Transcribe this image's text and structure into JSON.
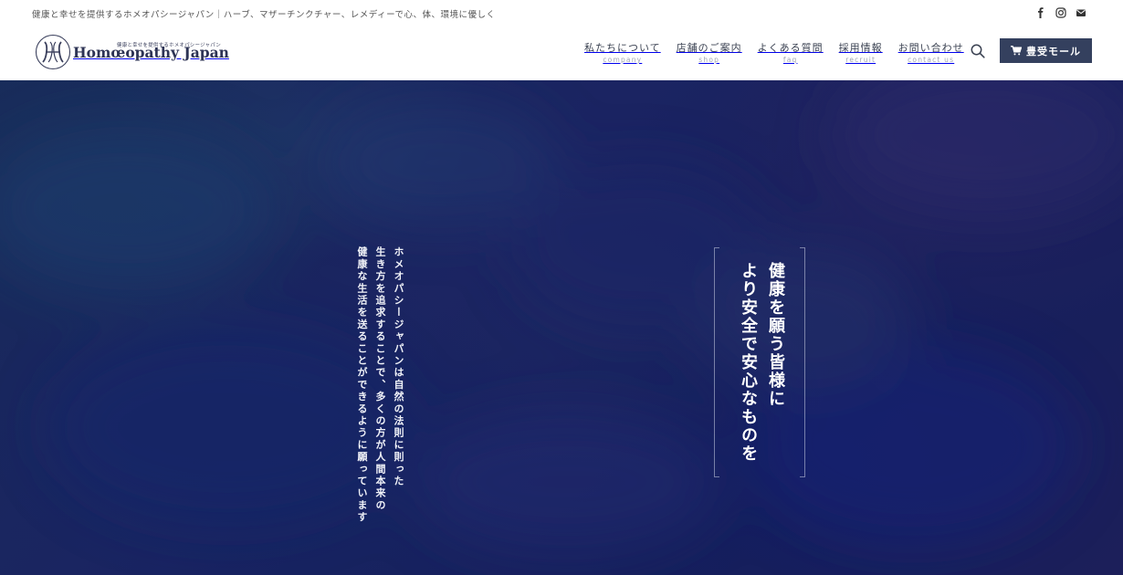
{
  "topbar": {
    "tagline": "健康と幸せを提供するホメオパシージャパン｜ハーブ、マザーチンクチャー、レメディーで心、体、環境に優しく",
    "social": [
      {
        "icon": "facebook-icon"
      },
      {
        "icon": "instagram-icon"
      },
      {
        "icon": "mail-icon"
      }
    ]
  },
  "header": {
    "logo": {
      "sub": "健康と幸せを提供するホメオパシージャパン",
      "main": "Homœopathy Japan"
    },
    "nav": [
      {
        "jp": "私たちについて",
        "en": "company"
      },
      {
        "jp": "店舗のご案内",
        "en": "shop"
      },
      {
        "jp": "よくある質問",
        "en": "faq"
      },
      {
        "jp": "採用情報",
        "en": "recruit"
      },
      {
        "jp": "お問い合わせ",
        "en": "contact us"
      }
    ],
    "search_icon": "search-icon",
    "shop_button": {
      "label": "豊受モール",
      "icon": "cart-icon"
    }
  },
  "hero": {
    "headline_lines": [
      "健康を願う皆様に",
      "より安全で安心なものを"
    ],
    "body_lines": [
      "ホメオパシージャパンは自然の法則に則った",
      "生き方を追求することで、多くの方が人間本来の",
      "健康な生活を送ることができるように願っています"
    ]
  },
  "colors": {
    "brand_navy": "#34405e",
    "hero_base": "#1b2462",
    "text_dark": "#3b4252"
  }
}
